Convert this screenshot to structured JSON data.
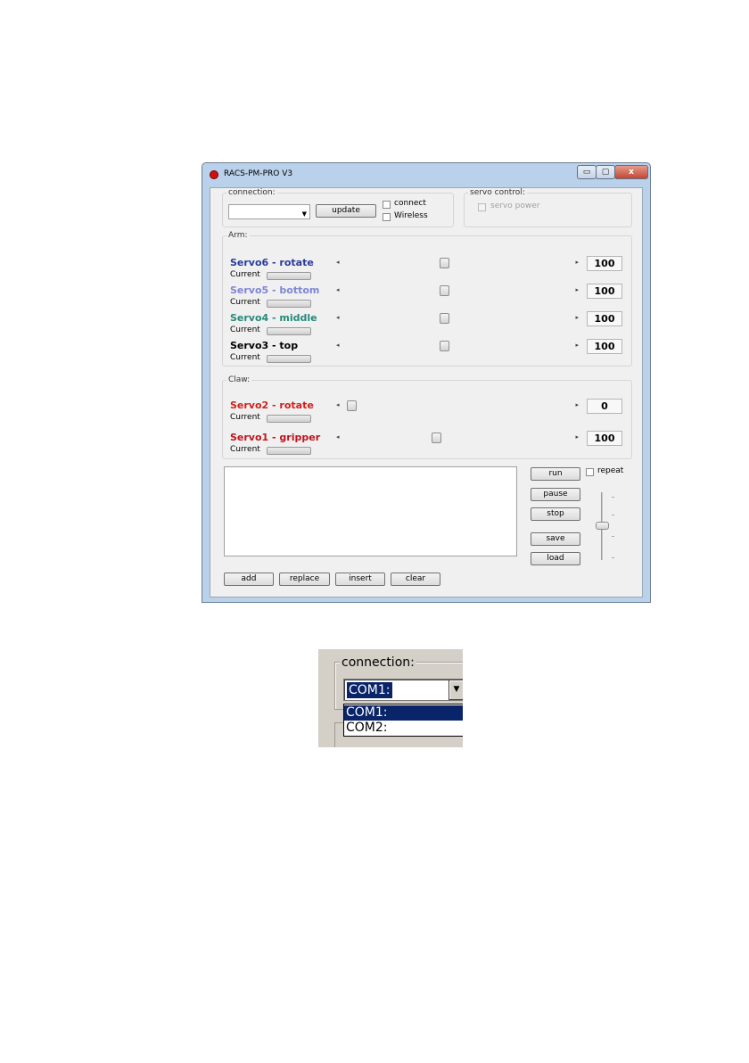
{
  "window": {
    "title": "RACS-PM-PRO V3",
    "min_glyph": "▭",
    "max_glyph": "▢",
    "close_glyph": "x"
  },
  "connection": {
    "legend": "connection:",
    "port_value": "",
    "update_label": "update",
    "connect_label": "connect",
    "wireless_label": "Wireless"
  },
  "servo_control": {
    "legend": "servo control:",
    "power_label": "servo power"
  },
  "arm": {
    "legend": "Arm:",
    "servos": [
      {
        "name": "Servo6 - rotate",
        "color": "#2a3b9c",
        "current_label": "Current",
        "value": "100",
        "slider_fraction": 0.44
      },
      {
        "name": "Servo5 - bottom",
        "color": "#7f86d4",
        "current_label": "Current",
        "value": "100",
        "slider_fraction": 0.44
      },
      {
        "name": "Servo4 - middle",
        "color": "#268a7a",
        "current_label": "Current",
        "value": "100",
        "slider_fraction": 0.44
      },
      {
        "name": "Servo3 - top",
        "color": "#000000",
        "current_label": "Current",
        "value": "100",
        "slider_fraction": 0.44
      }
    ]
  },
  "claw": {
    "legend": "Claw:",
    "servos": [
      {
        "name": "Servo2 - rotate",
        "color": "#d21f1f",
        "current_label": "Current",
        "value": "0",
        "slider_fraction": 0.0
      },
      {
        "name": "Servo1 - gripper",
        "color": "#c0141e",
        "current_label": "Current",
        "value": "100",
        "slider_fraction": 0.4
      }
    ]
  },
  "sequence": {
    "run_label": "run",
    "repeat_label": "repeat",
    "pause_label": "pause",
    "stop_label": "stop",
    "save_label": "save",
    "load_label": "load",
    "add_label": "add",
    "replace_label": "replace",
    "insert_label": "insert",
    "clear_label": "clear"
  },
  "zoom_inset": {
    "legend": "connection:",
    "selected_value": "COM1:",
    "options": [
      "COM1:",
      "COM2:"
    ],
    "highlighted_option": 0
  }
}
